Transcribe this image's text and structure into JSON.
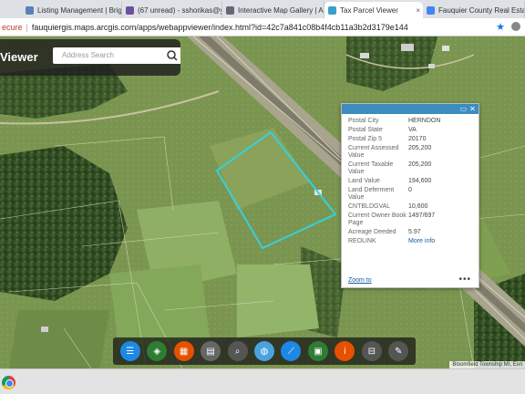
{
  "browser": {
    "tabs": [
      {
        "label": "Listing Management | Brig",
        "icon": "document-icon",
        "color": "#5b7fb8"
      },
      {
        "label": "(67 unread) - sshorikas@y",
        "icon": "mail-icon",
        "color": "#6b4fa0"
      },
      {
        "label": "Interactive Map Gallery | A",
        "icon": "globe-icon",
        "color": "#667"
      },
      {
        "label": "Tax Parcel Viewer",
        "icon": "map-icon",
        "color": "#3aa0c8"
      },
      {
        "label": "Fauquier County Real Esta",
        "icon": "google-icon",
        "color": "#4285f4"
      }
    ],
    "close_glyph": "×",
    "address": {
      "security": "ecure",
      "url": "fauquiergis.maps.arcgis.com/apps/webappviewer/index.html?id=42c7a841c08b4f4cb11a3b2d3179e144"
    }
  },
  "app": {
    "title": "Viewer",
    "search": {
      "placeholder": "Address Search"
    }
  },
  "popup": {
    "fields": [
      {
        "label": "Postal City",
        "value": "HERNDON"
      },
      {
        "label": "Postal State",
        "value": "VA"
      },
      {
        "label": "Postal Zip 5",
        "value": "20170"
      },
      {
        "label": "Current Assessed Value",
        "value": "205,200"
      },
      {
        "label": "Current Taxable Value",
        "value": "205,200"
      },
      {
        "label": "Land Value",
        "value": "194,600"
      },
      {
        "label": "Land Deferment Value",
        "value": "0"
      },
      {
        "label": "CNTBLDGVAL",
        "value": "10,600"
      },
      {
        "label": "Current Owner Book Page",
        "value": "1497/697"
      },
      {
        "label": "Acreage Deeded",
        "value": "5.97"
      },
      {
        "label": "REOLINK",
        "value": "More info",
        "link": true
      }
    ],
    "zoom_label": "Zoom to",
    "more_glyph": "•••"
  },
  "widgets": [
    {
      "name": "list-icon",
      "color": "#1e88e5"
    },
    {
      "name": "layers-icon",
      "color": "#2e7d32"
    },
    {
      "name": "basemap-gallery-icon",
      "color": "#e65100"
    },
    {
      "name": "attribute-table-icon",
      "color": "#666666"
    },
    {
      "name": "query-icon",
      "color": "#555555"
    },
    {
      "name": "globe-icon",
      "color": "#4aa3df"
    },
    {
      "name": "measure-icon",
      "color": "#1e88e5"
    },
    {
      "name": "print-icon",
      "color": "#2e7d32"
    },
    {
      "name": "info-icon",
      "color": "#e65100"
    },
    {
      "name": "scalebar-icon",
      "color": "#555555"
    },
    {
      "name": "draw-icon",
      "color": "#555555"
    }
  ],
  "attribution": "Bloomfield Township MI, Esri",
  "colors": {
    "parcel_outline": "#35d0e0",
    "popup_header": "#3c8cc0",
    "link": "#1a5aa0"
  }
}
